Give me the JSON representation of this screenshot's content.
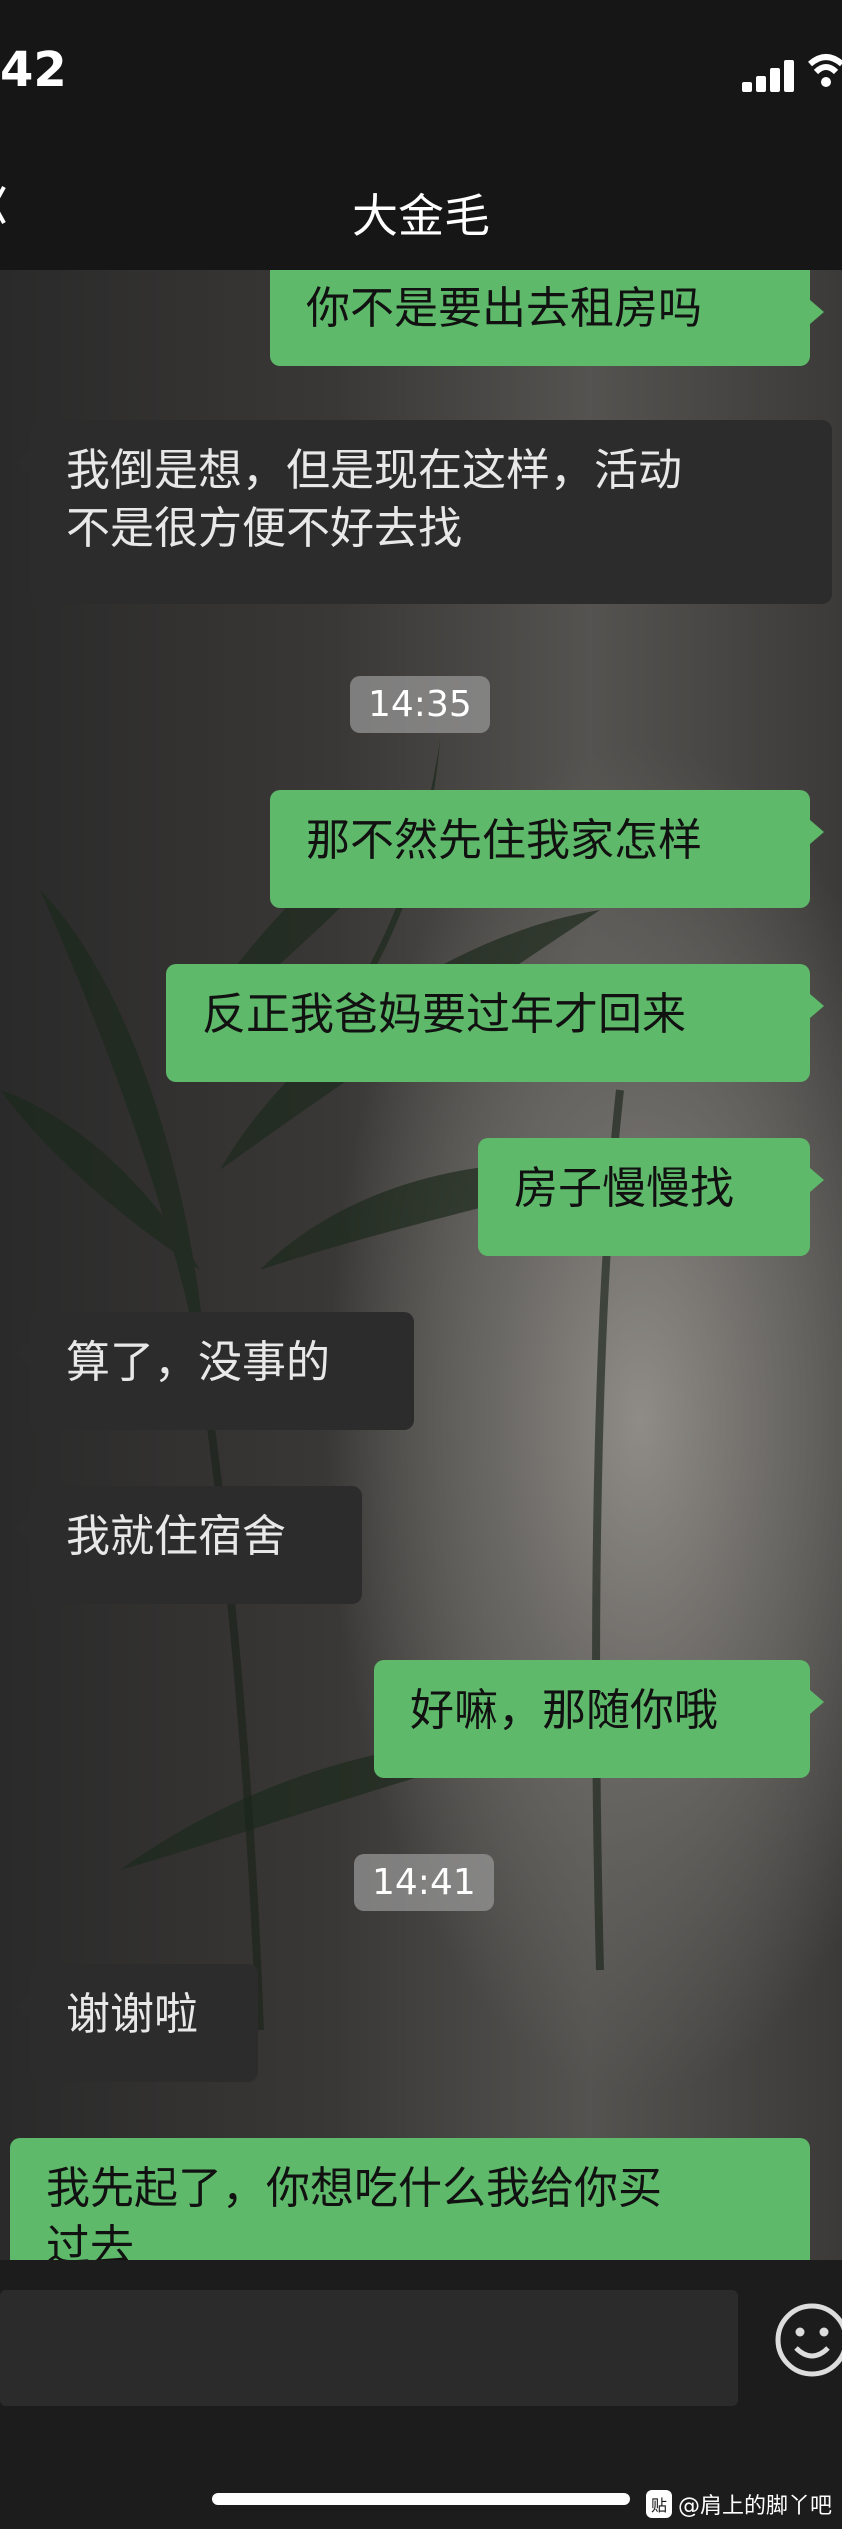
{
  "status": {
    "time": "42"
  },
  "header": {
    "title": "大金毛"
  },
  "messages": [
    {
      "from": "me",
      "text": "你不是要出去租房吗"
    },
    {
      "from": "them",
      "text_line1": "我倒是想，但是现在这样，活动",
      "text_line2": "不是很方便不好去找"
    },
    {
      "from": "me",
      "text": "那不然先住我家怎样"
    },
    {
      "from": "me",
      "text": "反正我爸妈要过年才回来"
    },
    {
      "from": "me",
      "text": "房子慢慢找"
    },
    {
      "from": "them",
      "text": "算了，没事的"
    },
    {
      "from": "them",
      "text": "我就住宿舍"
    },
    {
      "from": "me",
      "text": "好嘛，那随你哦"
    },
    {
      "from": "them",
      "text": "谢谢啦"
    },
    {
      "from": "me",
      "text_line1": "我先起了，你想吃什么我给你买",
      "text_line2": "过去"
    }
  ],
  "timestamps": [
    "14:35",
    "14:41"
  ],
  "input": {
    "emoji_icon": "smiley-face-icon"
  },
  "watermark": {
    "logo": "贴",
    "text": "@肩上的脚丫吧"
  },
  "colors": {
    "me_bubble": "#5eb96a",
    "them_bubble": "#2c2c2c"
  }
}
